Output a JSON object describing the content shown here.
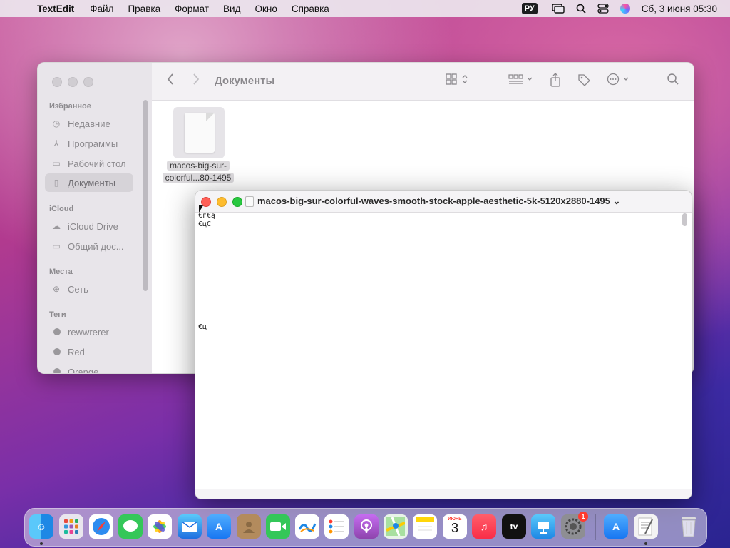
{
  "menubar": {
    "app_name": "TextEdit",
    "menus": [
      "Файл",
      "Правка",
      "Формат",
      "Вид",
      "Окно",
      "Справка"
    ],
    "input_source": "РУ",
    "clock": "Сб, 3 июня  05:30"
  },
  "finder": {
    "title": "Документы",
    "sidebar": {
      "favorites_header": "Избранное",
      "favorites": [
        {
          "label": "Недавние",
          "icon": "clock-icon"
        },
        {
          "label": "Программы",
          "icon": "apps-icon"
        },
        {
          "label": "Рабочий стол",
          "icon": "desktop-icon"
        },
        {
          "label": "Документы",
          "icon": "document-icon",
          "active": true
        }
      ],
      "icloud_header": "iCloud",
      "icloud": [
        {
          "label": "iCloud Drive",
          "icon": "cloud-icon"
        },
        {
          "label": "Общий дос...",
          "icon": "shared-folder-icon"
        }
      ],
      "locations_header": "Места",
      "locations": [
        {
          "label": "Сеть",
          "icon": "globe-icon"
        }
      ],
      "tags_header": "Теги",
      "tags": [
        {
          "label": "rewwrerer"
        },
        {
          "label": "Red"
        },
        {
          "label": "Orange"
        }
      ]
    },
    "file": {
      "label_line1": "macos-big-sur-",
      "label_line2": "colorful...80-1495"
    }
  },
  "textedit": {
    "title": "macos-big-sur-colorful-waves-smooth-stock-apple-aesthetic-5k-5120x2880-1495",
    "lines": [
      "€г€ą",
      "€цС",
      "€ц"
    ]
  },
  "dock": {
    "calendar_month": "ИЮНЬ",
    "calendar_day": "3",
    "settings_badge": "1",
    "tv_label": "tv"
  }
}
